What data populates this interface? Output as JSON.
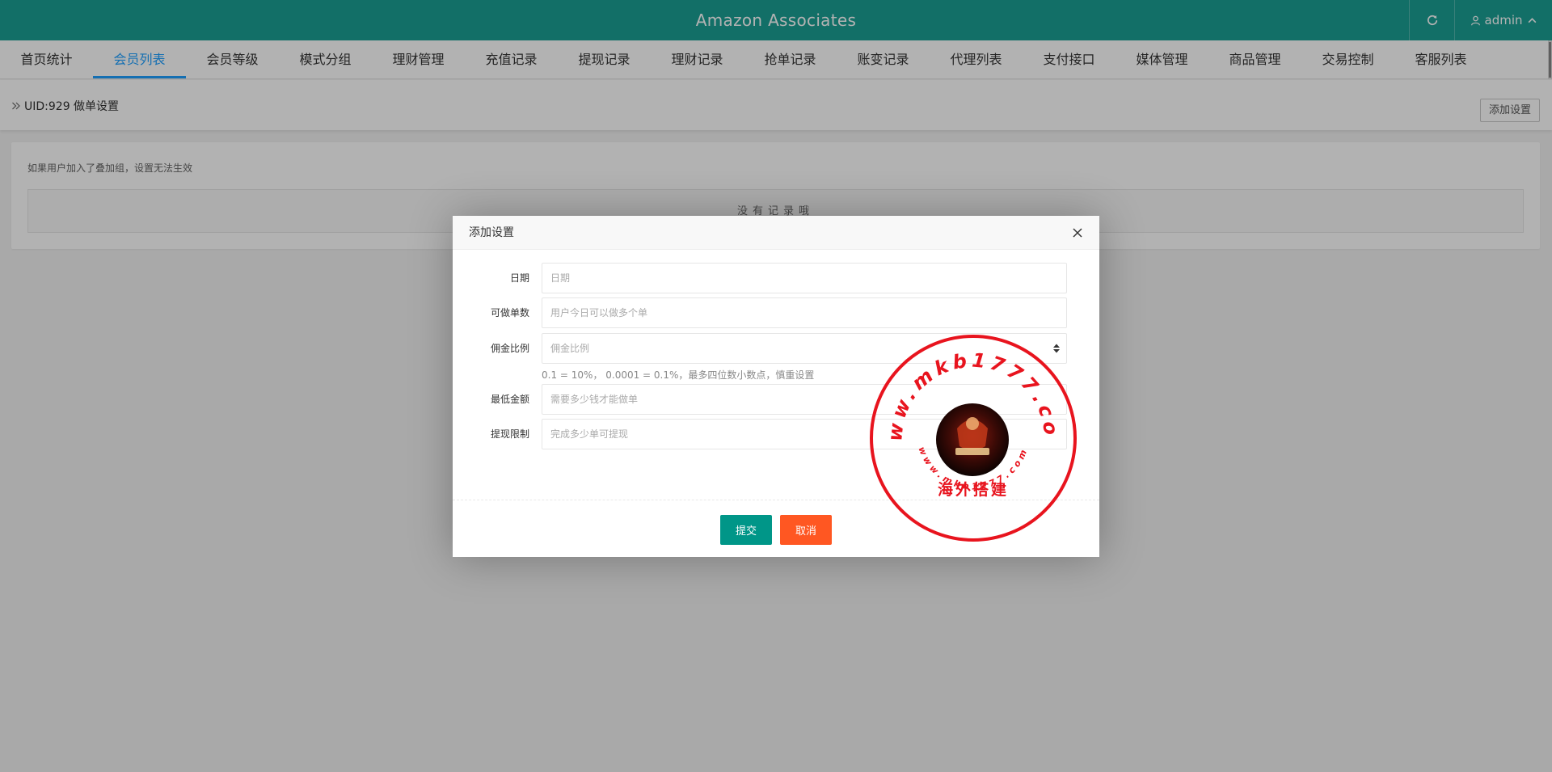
{
  "header": {
    "title": "Amazon Associates",
    "refresh_icon": "refresh-icon",
    "user_icon": "user-icon",
    "username": "admin"
  },
  "nav": {
    "items": [
      {
        "label": "首页统计"
      },
      {
        "label": "会员列表",
        "active": true
      },
      {
        "label": "会员等级"
      },
      {
        "label": "模式分组"
      },
      {
        "label": "理财管理"
      },
      {
        "label": "充值记录"
      },
      {
        "label": "提现记录"
      },
      {
        "label": "理财记录"
      },
      {
        "label": "抢单记录"
      },
      {
        "label": "账变记录"
      },
      {
        "label": "代理列表"
      },
      {
        "label": "支付接口"
      },
      {
        "label": "媒体管理"
      },
      {
        "label": "商品管理"
      },
      {
        "label": "交易控制"
      },
      {
        "label": "客服列表"
      }
    ]
  },
  "breadcrumb": {
    "text": "UID:929 做单设置",
    "add_button": "添加设置"
  },
  "card": {
    "notice": "如果用户加入了叠加组，设置无法生效",
    "empty_text": "没有记录哦"
  },
  "modal": {
    "title": "添加设置",
    "fields": [
      {
        "label": "日期",
        "placeholder": "日期"
      },
      {
        "label": "可做单数",
        "placeholder": "用户今日可以做多个单"
      },
      {
        "label": "佣金比例",
        "placeholder": "佣金比例",
        "hint": "0.1 = 10%， 0.0001 = 0.1%，最多四位数小数点，慎重设置"
      },
      {
        "label": "最低金额",
        "placeholder": "需要多少钱才能做单"
      },
      {
        "label": "提现限制",
        "placeholder": "完成多少单可提现"
      }
    ],
    "submit": "提交",
    "cancel": "取消"
  },
  "watermark": {
    "url_top": "www.mkb1777.com",
    "url_bottom": "www.mkb1777.com",
    "caption": "海外搭建"
  },
  "colors": {
    "header_bg": "#1aa094",
    "nav_active": "#1e9fff",
    "submit_btn": "#009688",
    "cancel_btn": "#ff5722",
    "stamp_red": "#e8141e"
  }
}
